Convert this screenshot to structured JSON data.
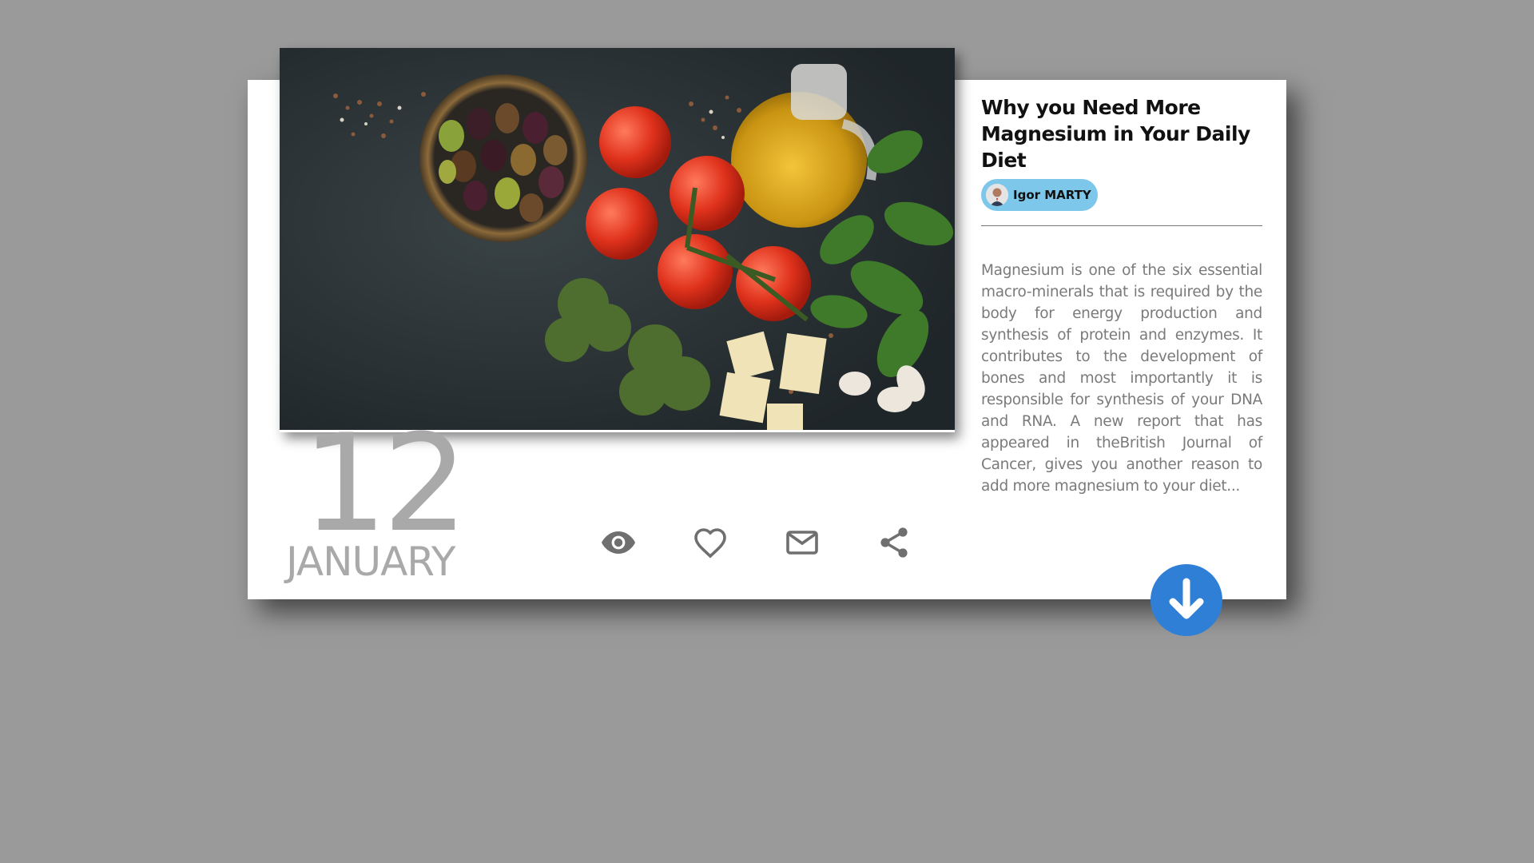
{
  "post": {
    "title": "Why you Need More Magnesium in Your Daily Diet",
    "author": "Igor MARTY",
    "date_day": "12",
    "date_month": "JANUARY",
    "excerpt": "Magnesium is one of the six essential macro-minerals that is required by the body for energy production and synthesis of protein and enzymes. It contributes to the development of bones and most importantly it is responsible for synthesis of your DNA and RNA. A new report that has appeared in theBritish Journal of Cancer, gives you another reason to add more magnesium to your diet..."
  },
  "actions": {
    "icons": [
      "eye-icon",
      "heart-icon",
      "mail-icon",
      "share-icon"
    ]
  },
  "colors": {
    "background": "#9a9a9a",
    "card": "#ffffff",
    "author_badge": "#7cc7ea",
    "download_button": "#2f7fd6",
    "date_text": "#a9a9a9",
    "excerpt_text": "#7a7a7a"
  }
}
